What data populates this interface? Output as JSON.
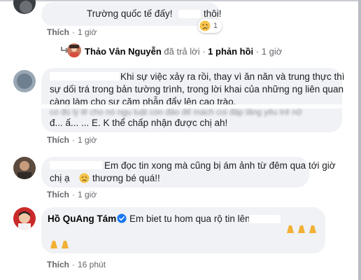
{
  "comments": [
    {
      "author": "",
      "lines": [
        "Trường quốc tế đấy!",
        "thôi!"
      ],
      "reaction_count": "1",
      "actions": {
        "like": "Thích",
        "time": "1 giờ"
      }
    },
    {
      "author": "",
      "lines": [
        "Khi sự việc xảy ra rồi, thay vì ăn năn và trung thực thì",
        "sự dối trá trong bản tường trình, trong lời khai của những ng liên quan",
        "càng làm cho sự căm phẫn đẩy lên cao trào.",
        "có đủ lý lẽ cho nó ngu luật còn đảo để mách coi đập lắng yêu trẻ nữ",
        "đ... ấ... ... E. K thể chấp nhận được chị ah!"
      ],
      "actions": {
        "like": "Thích",
        "time": "1 giờ"
      }
    },
    {
      "author": "",
      "lines": [
        "Em đọc tin xong mà cũng bị ám ảnh từ đêm qua tới giờ",
        "chị ạ",
        "thương bé quá!!"
      ],
      "actions": {
        "like": "Thích",
        "time": "1 giờ"
      }
    },
    {
      "author": "Hồ QuAng Tám",
      "lines": [
        "Em biet tu hom qua rộ tin lên. N"
      ],
      "actions": {
        "like": "Thích",
        "time": "16 phút"
      }
    }
  ],
  "reply_thread": {
    "name": "Thảo Vân Nguyễn",
    "verb": "đã trả lời",
    "separator": "·",
    "count_label": "1 phản hồi",
    "time": "1 giờ"
  },
  "icons": {
    "reply_arrow": "reply-arrow-icon",
    "verified": "verified-badge-icon",
    "crying_face": "crying-face-emoji",
    "praying_hands": "praying-hands-emoji"
  },
  "colors": {
    "bubble": "#f0f2f5",
    "meta_text": "#65676b",
    "verified": "#1877f2",
    "emoji": "#f7c34a"
  }
}
